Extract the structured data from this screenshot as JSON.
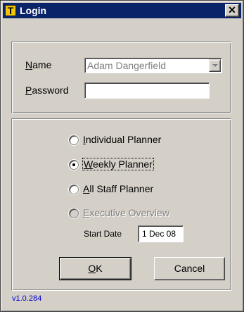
{
  "window": {
    "title": "Login",
    "icon_letter": "T",
    "close_glyph": "✕",
    "title_bar_color": "#0a246a",
    "app_icon_color": "#f5c400"
  },
  "login": {
    "name_label_ul": "N",
    "name_label_rest": "ame",
    "name_value": "Adam Dangerfield",
    "password_label_ul": "P",
    "password_label_rest": "assword",
    "password_value": ""
  },
  "planner": {
    "options": [
      {
        "label_ul": "I",
        "label_rest": "ndividual Planner",
        "selected": false,
        "enabled": true
      },
      {
        "label_ul": "W",
        "label_rest": "eekly Planner",
        "selected": true,
        "enabled": true
      },
      {
        "label_ul": "A",
        "label_rest": "ll Staff Planner",
        "selected": false,
        "enabled": true
      },
      {
        "label_ul": "E",
        "label_rest": "xecutive Overview",
        "selected": false,
        "enabled": false
      }
    ],
    "start_date_label": "Start Date",
    "start_date_value": "1 Dec 08"
  },
  "buttons": {
    "ok_ul": "O",
    "ok_rest": "K",
    "cancel_label": "Cancel"
  },
  "version": "v1.0.284"
}
